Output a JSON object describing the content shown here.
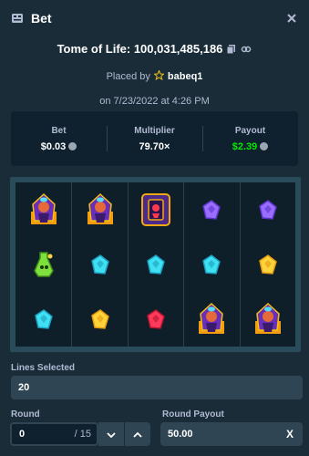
{
  "header": {
    "title": "Bet",
    "close_icon": "close-icon",
    "bet_icon": "ticket-icon"
  },
  "game": {
    "title": "Tome of Life: 100,031,485,186",
    "placed_by_label": "Placed by",
    "username": "babeq1",
    "date": "on 7/23/2022 at 4:26 PM"
  },
  "stats": {
    "bet_label": "Bet",
    "bet_value": "$0.03",
    "multiplier_label": "Multiplier",
    "multiplier_value": "79.70×",
    "payout_label": "Payout",
    "payout_value": "$2.39",
    "payout_color": "#00e701"
  },
  "reels": [
    [
      "priestess",
      "green-potion",
      "cyan-gem"
    ],
    [
      "priestess",
      "cyan-gem",
      "yellow-gem"
    ],
    [
      "tome",
      "cyan-gem",
      "red-gem"
    ],
    [
      "purple-gem",
      "cyan-gem",
      "priestess"
    ],
    [
      "purple-gem",
      "yellow-gem",
      "priestess"
    ]
  ],
  "lines": {
    "label": "Lines Selected",
    "value": "20"
  },
  "round": {
    "label": "Round",
    "value": "0",
    "total": "/ 15"
  },
  "round_payout": {
    "label": "Round Payout",
    "value": "50.00",
    "clear_label": "X"
  }
}
